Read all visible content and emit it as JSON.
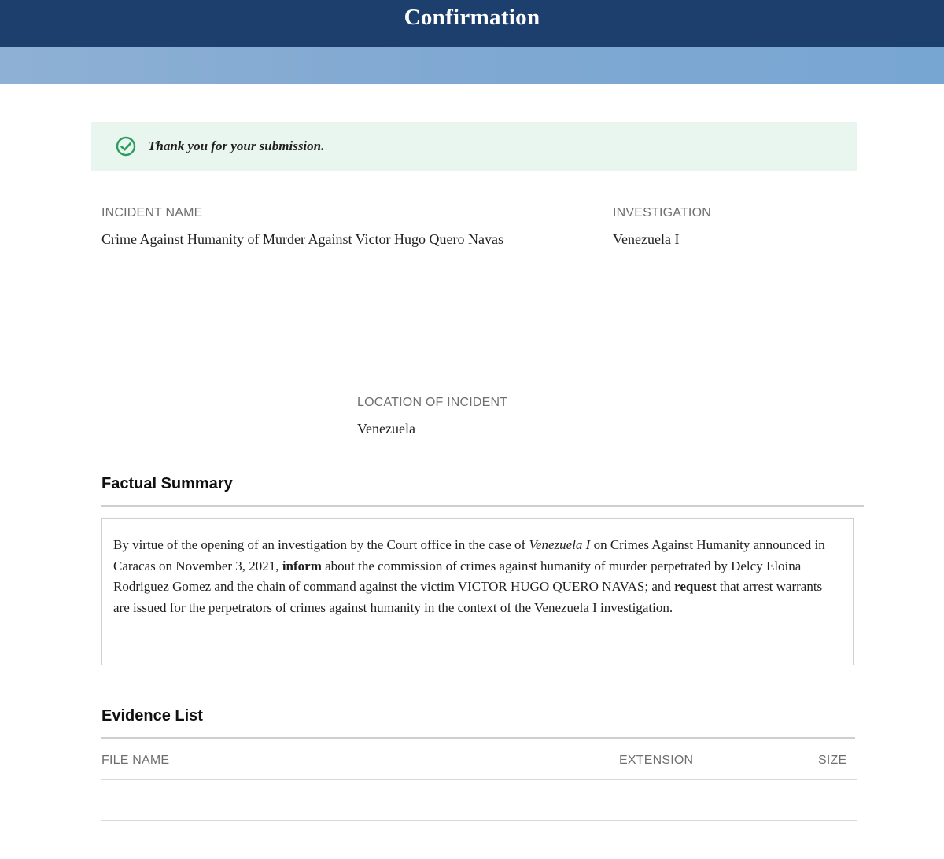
{
  "header": {
    "title": "Confirmation"
  },
  "banner": {
    "message": "Thank you for your submission.",
    "icon": "check-circle-icon",
    "icon_color": "#2e9b5f",
    "background": "#e9f6f0"
  },
  "fields": {
    "incident_name_label": "INCIDENT NAME",
    "incident_name_value": "Crime Against Humanity of Murder Against Victor Hugo Quero Navas",
    "investigation_label": "INVESTIGATION",
    "investigation_value": "Venezuela I",
    "location_label": "LOCATION OF INCIDENT",
    "location_value": "Venezuela"
  },
  "factual_summary": {
    "title": "Factual Summary",
    "seg1": "By virtue of the opening of an investigation by the Court office in the case of ",
    "seg2_italic": "Venezuela I",
    "seg3": " on Crimes Against Humanity announced in Caracas on November 3, 2021, ",
    "seg4_bold": "inform",
    "seg5": " about the commission of crimes against humanity of murder perpetrated by Delcy Eloina Rodriguez Gomez and the chain of command against the victim VICTOR HUGO QUERO NAVAS; and ",
    "seg6_bold": "request",
    "seg7": " that arrest warrants are issued for the perpetrators of crimes against humanity in the context of the Venezuela I investigation."
  },
  "evidence": {
    "title": "Evidence List",
    "columns": {
      "file_name": "FILE NAME",
      "extension": "EXTENSION",
      "size": "SIZE"
    }
  },
  "colors": {
    "header": "#1c3f6e",
    "sub_band": "#7fa8d2"
  }
}
